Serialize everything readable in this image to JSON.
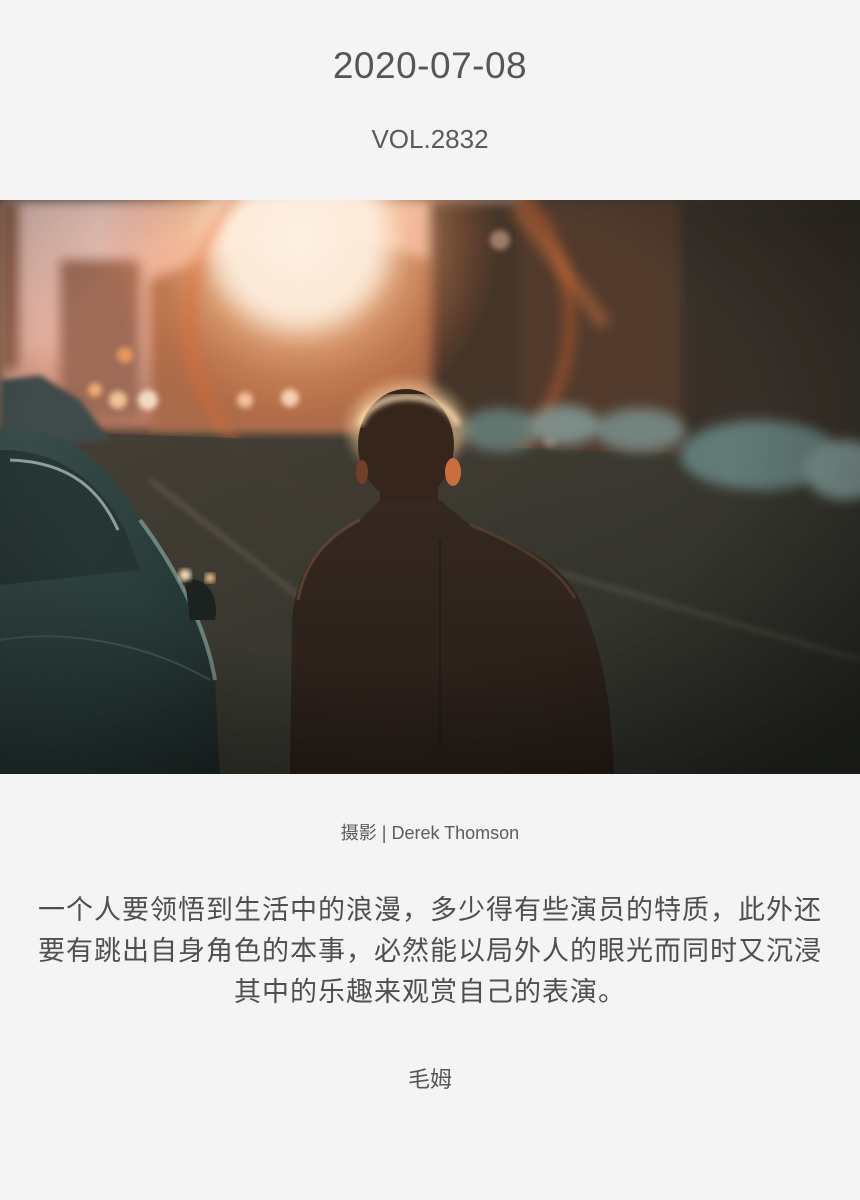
{
  "header": {
    "date": "2020-07-08",
    "volume": "VOL.2832"
  },
  "photo": {
    "subject": "man-walking-on-sunlit-street",
    "credit": "摄影 | Derek Thomson"
  },
  "quote": {
    "text": "一个人要领悟到生活中的浪漫，多少得有些演员的特质，此外还要有跳出自身角色的本事，必然能以局外人的眼光而同时又沉浸其中的乐趣来观赏自己的表演。",
    "author": "毛姆"
  },
  "colors": {
    "background": "#f4f4f4",
    "text": "#555555",
    "sun": "#ffe2c4",
    "flare": "#e8642a"
  }
}
